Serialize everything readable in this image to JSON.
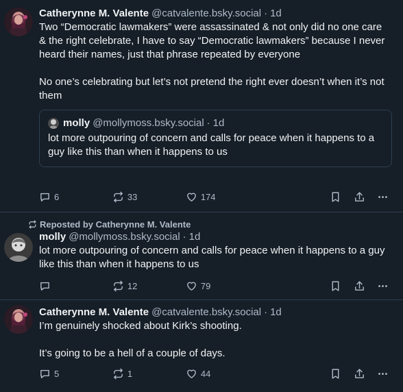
{
  "posts": [
    {
      "author_name": "Catherynne M. Valente",
      "author_handle": "@catvalente.bsky.social",
      "separator": "·",
      "time": "1d",
      "paragraphs": [
        "Two “Democratic lawmakers” were assassinated & not only did no one care & the right celebrate, I have to say “Democratic lawmakers” because I never heard their names, just that phrase repeated by everyone",
        "No one’s celebrating but let’s not pretend the right ever doesn’t when it’s not them"
      ],
      "quote": {
        "author_name": "molly",
        "author_handle": "@mollymoss.bsky.social",
        "separator": "·",
        "time": "1d",
        "text": "lot more outpouring of concern and calls for peace when it happens to a guy like this than when it happens to us"
      },
      "replies": "6",
      "reposts": "33",
      "likes": "174"
    },
    {
      "repost_label": "Reposted by Catherynne M. Valente",
      "author_name": "molly",
      "author_handle": "@mollymoss.bsky.social",
      "separator": "·",
      "time": "1d",
      "text": "lot more outpouring of concern and calls for peace when it happens to a guy like this than when it happens to us",
      "replies": "",
      "reposts": "12",
      "likes": "79"
    },
    {
      "author_name": "Catherynne M. Valente",
      "author_handle": "@catvalente.bsky.social",
      "separator": "·",
      "time": "1d",
      "paragraphs": [
        "I’m genuinely shocked about Kirk’s shooting.",
        "It’s going to be a hell of a couple of days."
      ],
      "replies": "5",
      "reposts": "1",
      "likes": "44"
    }
  ],
  "colors": {
    "background": "#161e27",
    "text": "#f1f3f5",
    "muted": "#aebbc9",
    "border": "#2e4052"
  },
  "icons": [
    "reply-icon",
    "repost-icon",
    "like-icon",
    "bookmark-icon",
    "share-icon",
    "more-icon"
  ]
}
